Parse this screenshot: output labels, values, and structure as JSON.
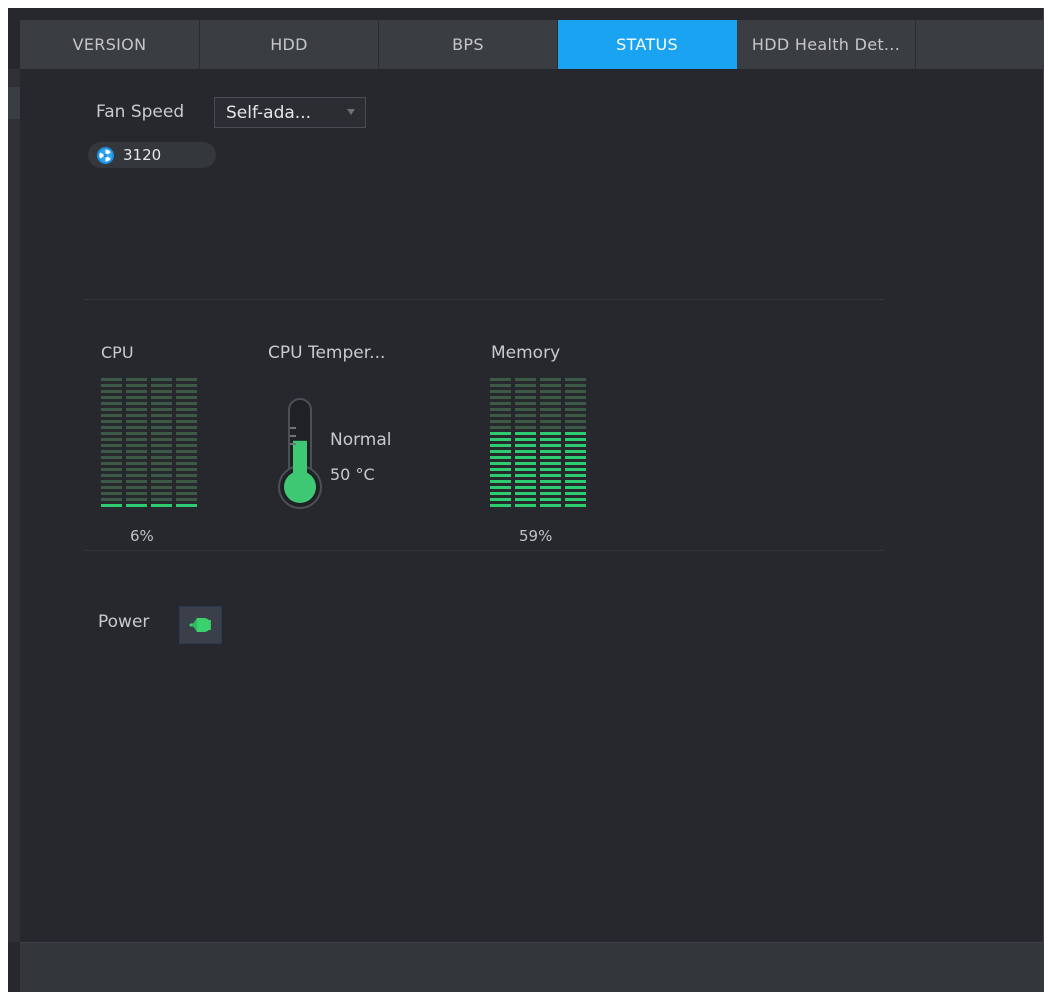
{
  "tabs": [
    {
      "label": "VERSION",
      "active": false
    },
    {
      "label": "HDD",
      "active": false
    },
    {
      "label": "BPS",
      "active": false
    },
    {
      "label": "STATUS",
      "active": true
    },
    {
      "label": "HDD Health Det...",
      "active": false
    }
  ],
  "fan": {
    "label": "Fan Speed",
    "mode": "Self-ada...",
    "rpm": "3120",
    "icon": "fan-icon"
  },
  "cpu": {
    "label": "CPU",
    "usage_text": "6%",
    "usage": 0.06
  },
  "cpu_temperature": {
    "label": "CPU Temper...",
    "status": "Normal",
    "value": "50 °C",
    "level": 0.55
  },
  "memory": {
    "label": "Memory",
    "usage_text": "59%",
    "usage": 0.59
  },
  "power": {
    "label": "Power",
    "icon": "power-plug-icon"
  },
  "colors": {
    "accent": "#1aa3f0",
    "gauge_on": "#2ecc71",
    "gauge_off": "#3d5a47",
    "therm_fill": "#3ec874"
  }
}
